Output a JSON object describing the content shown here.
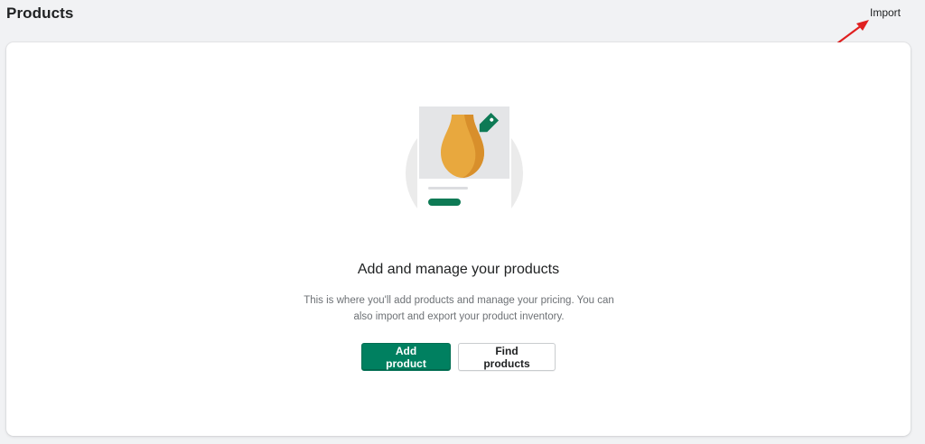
{
  "header": {
    "title": "Products",
    "import_label": "Import"
  },
  "empty_state": {
    "heading": "Add and manage your products",
    "body": "This is where you'll add products and manage your pricing. You can also import and export your product inventory.",
    "primary_action": "Add product",
    "secondary_action": "Find products"
  },
  "colors": {
    "primary": "#008060",
    "annotation_arrow": "#e02020",
    "page_background": "#f1f2f4"
  },
  "icons": [
    "product-vase-illustration",
    "price-tag-icon",
    "annotation-arrow"
  ]
}
